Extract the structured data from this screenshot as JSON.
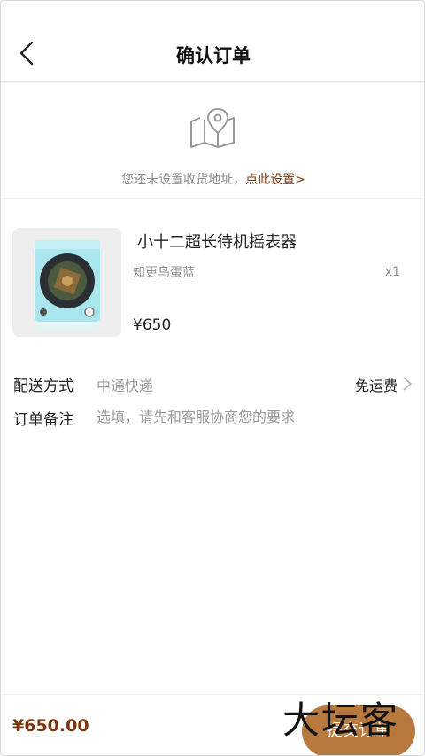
{
  "header": {
    "title": "确认订单",
    "back_icon": "chevron-left-icon"
  },
  "address": {
    "icon": "map-pin-icon",
    "hint": "您还未设置收货地址，",
    "link": "点此设置>"
  },
  "product": {
    "name": "小十二超长待机摇表器",
    "variant": "知更鸟蛋蓝",
    "quantity": "x1",
    "price": "¥650",
    "thumb_color": "#a9e6ee"
  },
  "shipping": {
    "label": "配送方式",
    "method": "中通快递",
    "fee": "免运费"
  },
  "remark": {
    "label": "订单备注",
    "placeholder": "选填，请先和客服协商您的要求"
  },
  "footer": {
    "total": "¥650.00",
    "submit_label": "提交订单"
  },
  "watermark": "大坛客",
  "colors": {
    "accent": "#7a3510",
    "button": "#b8793f"
  }
}
